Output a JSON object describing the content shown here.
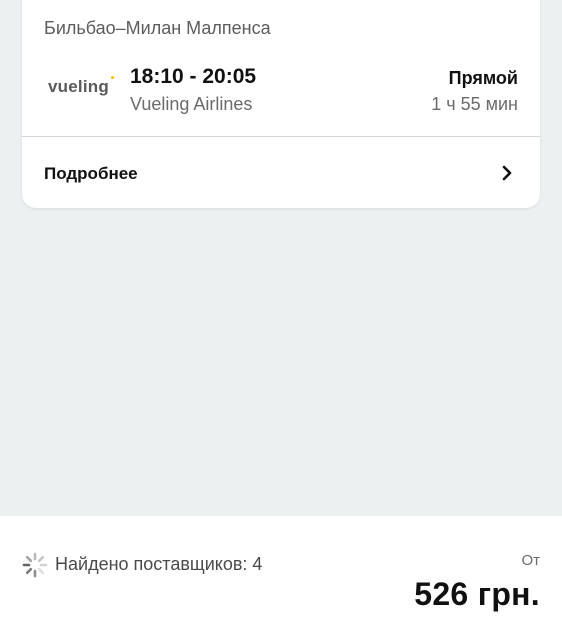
{
  "flight_card": {
    "route": "Бильбао–Милан Малпенса",
    "airline_logo_text": "vueling",
    "times": "18:10 - 20:05",
    "airline_name": "Vueling Airlines",
    "stops": "Прямой",
    "duration": "1 ч 55 мин",
    "details_label": "Подробнее",
    "logo_accent_color": "#f2c200"
  },
  "footer": {
    "providers_found": "Найдено поставщиков: 4",
    "from_label": "От",
    "price": "526 грн.",
    "spinner_icon": "loading-spinner-icon"
  },
  "colors": {
    "background": "#edf0f1",
    "card": "#ffffff",
    "text_primary": "#111111",
    "text_secondary": "#6b6b6b"
  }
}
